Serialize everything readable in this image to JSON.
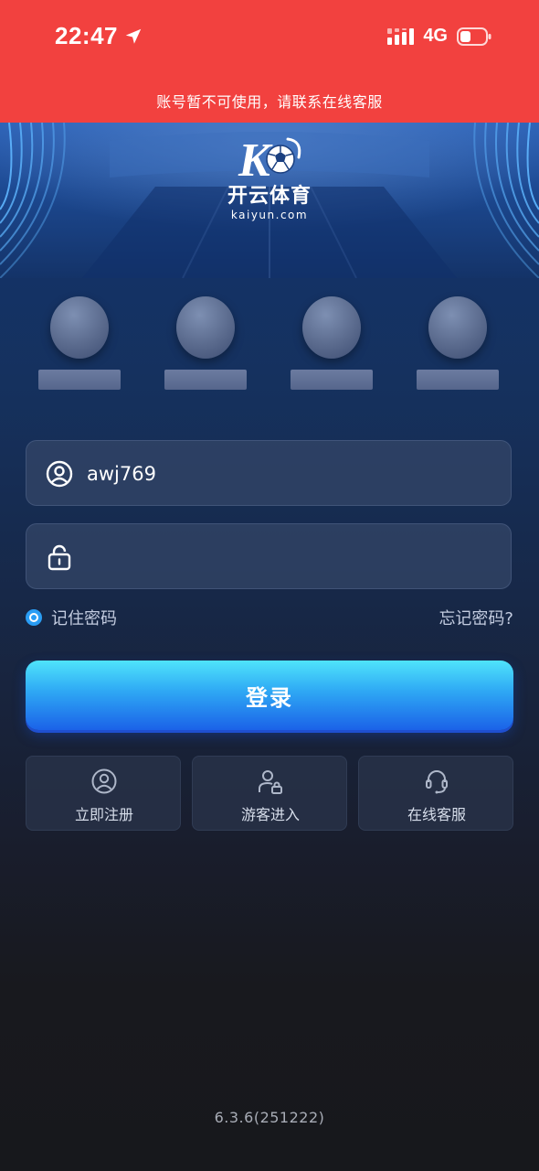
{
  "status_bar": {
    "time": "22:47",
    "network": "4G",
    "icons": [
      "location-arrow-icon",
      "signal-icon",
      "battery-icon"
    ]
  },
  "notice": "账号暂不可使用，请联系在线客服",
  "brand": {
    "name_cn": "开云体育",
    "domain": "kaiyun.com",
    "logo_mark_text": "K"
  },
  "saved_accounts_count": 4,
  "login_form": {
    "username_value": "awj769",
    "password_value": "",
    "remember_label": "记住密码",
    "remember_checked": true,
    "forgot_label": "忘记密码?",
    "submit_label": "登录"
  },
  "quick_actions": [
    {
      "label": "立即注册",
      "icon": "user-circle-icon"
    },
    {
      "label": "游客进入",
      "icon": "guest-user-icon"
    },
    {
      "label": "在线客服",
      "icon": "headset-icon"
    }
  ],
  "version": "6.3.6(251222)",
  "colors": {
    "notice_bg": "#f2413f",
    "accent": "#2a9df4",
    "button_top": "#4fe4fb",
    "button_bottom": "#1b62e8"
  }
}
